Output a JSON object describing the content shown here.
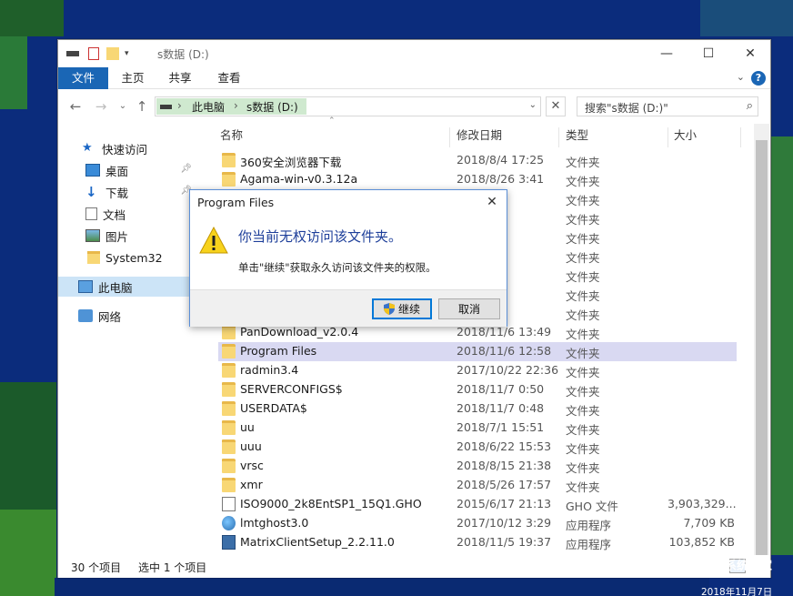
{
  "window": {
    "title": "s数据 (D:)",
    "controls": {
      "minimize": "—",
      "maximize": "☐",
      "close": "✕"
    }
  },
  "ribbon": {
    "tabs": [
      "文件",
      "主页",
      "共享",
      "查看"
    ],
    "help": "?",
    "collapse": "⌄"
  },
  "address": {
    "crumbs": [
      "此电脑",
      "s数据 (D:)"
    ],
    "separator": "›",
    "dropdown": "⌄",
    "clear": "✕"
  },
  "search": {
    "placeholder": "搜索\"s数据 (D:)\"",
    "icon": "search-icon"
  },
  "nav": {
    "back": "←",
    "forward": "→",
    "recent": "⌄",
    "up": "↑",
    "items": [
      {
        "label": "快速访问",
        "icon": "star-icon"
      },
      {
        "label": "桌面",
        "icon": "desktop-icon"
      },
      {
        "label": "下载",
        "icon": "download-icon"
      },
      {
        "label": "文档",
        "icon": "document-icon"
      },
      {
        "label": "图片",
        "icon": "picture-icon"
      },
      {
        "label": "System32",
        "icon": "folder-icon"
      },
      {
        "label": "此电脑",
        "icon": "computer-icon"
      },
      {
        "label": "网络",
        "icon": "network-icon"
      }
    ]
  },
  "columns": {
    "name": "名称",
    "date": "修改日期",
    "type": "类型",
    "size": "大小"
  },
  "files": [
    {
      "name": "360安全浏览器下载",
      "date": "2018/8/4 17:25",
      "type": "文件夹",
      "size": "",
      "kind": "folder"
    },
    {
      "name": "Agama-win-v0.3.12a",
      "date": "2018/8/26 3:41",
      "type": "文件夹",
      "size": "",
      "kind": "folder"
    },
    {
      "name": "",
      "date": "2 22:30",
      "type": "文件夹",
      "size": "",
      "kind": "folder"
    },
    {
      "name": "",
      "date": "7 13:51",
      "type": "文件夹",
      "size": "",
      "kind": "folder"
    },
    {
      "name": "",
      "date": "5 8:13",
      "type": "文件夹",
      "size": "",
      "kind": "folder"
    },
    {
      "name": "",
      "date": "4 9:22",
      "type": "文件夹",
      "size": "",
      "kind": "folder"
    },
    {
      "name": "",
      "date": "6 0:51",
      "type": "文件夹",
      "size": "",
      "kind": "folder"
    },
    {
      "name": "",
      "date": "19:23",
      "type": "文件夹",
      "size": "",
      "kind": "folder"
    },
    {
      "name": "",
      "date": "2 2:13",
      "type": "文件夹",
      "size": "",
      "kind": "folder"
    },
    {
      "name": "PanDownload_v2.0.4",
      "date": "2018/11/6 13:49",
      "type": "文件夹",
      "size": "",
      "kind": "folder"
    },
    {
      "name": "Program Files",
      "date": "2018/11/6 12:58",
      "type": "文件夹",
      "size": "",
      "kind": "folder",
      "selected": true
    },
    {
      "name": "radmin3.4",
      "date": "2017/10/22 22:36",
      "type": "文件夹",
      "size": "",
      "kind": "folder"
    },
    {
      "name": "SERVERCONFIGS$",
      "date": "2018/11/7 0:50",
      "type": "文件夹",
      "size": "",
      "kind": "folder"
    },
    {
      "name": "USERDATA$",
      "date": "2018/11/7 0:48",
      "type": "文件夹",
      "size": "",
      "kind": "folder"
    },
    {
      "name": "uu",
      "date": "2018/7/1 15:51",
      "type": "文件夹",
      "size": "",
      "kind": "folder"
    },
    {
      "name": "uuu",
      "date": "2018/6/22 15:53",
      "type": "文件夹",
      "size": "",
      "kind": "folder"
    },
    {
      "name": "vrsc",
      "date": "2018/8/15 21:38",
      "type": "文件夹",
      "size": "",
      "kind": "folder"
    },
    {
      "name": "xmr",
      "date": "2018/5/26 17:57",
      "type": "文件夹",
      "size": "",
      "kind": "folder"
    },
    {
      "name": "ISO9000_2k8EntSP1_15Q1.GHO",
      "date": "2015/6/17 21:13",
      "type": "GHO 文件",
      "size": "3,903,329...",
      "kind": "file"
    },
    {
      "name": "lmtghost3.0",
      "date": "2017/10/12 3:29",
      "type": "应用程序",
      "size": "7,709 KB",
      "kind": "app"
    },
    {
      "name": "MatrixClientSetup_2.2.11.0",
      "date": "2018/11/5 19:37",
      "type": "应用程序",
      "size": "103,852 KB",
      "kind": "app2"
    }
  ],
  "status": {
    "count": "30 个项目",
    "selected": "选中 1 个项目"
  },
  "dialog": {
    "title": "Program Files",
    "close": "✕",
    "message": "你当前无权访问该文件夹。",
    "detail": "单击\"继续\"获取永久访问该文件夹的权限。",
    "continue": "继续",
    "cancel": "取消",
    "warning_icon": "warning-icon"
  },
  "watermark": {
    "line1": "系统之家",
    "line2": "2018年11月7日"
  }
}
